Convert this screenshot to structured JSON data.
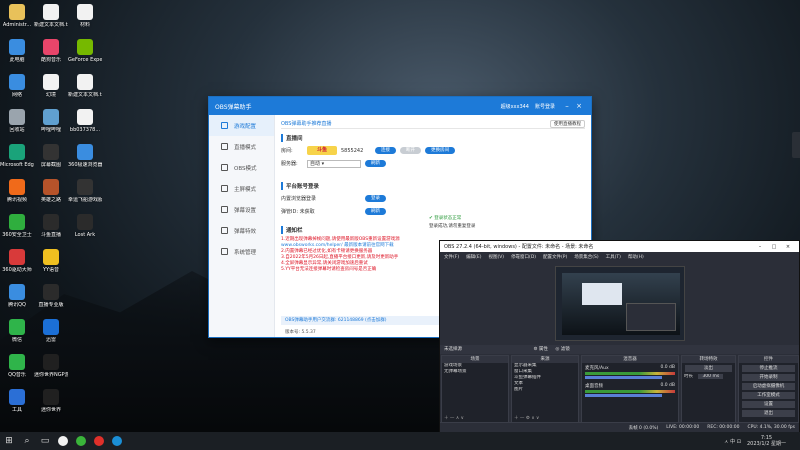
{
  "desktop": {
    "icons": [
      {
        "label": "Administr...",
        "color": "#e8c15a"
      },
      {
        "label": "此电脑",
        "color": "#3a8de0"
      },
      {
        "label": "网络",
        "color": "#3a8de0"
      },
      {
        "label": "回收站",
        "color": "#9aa4ad"
      },
      {
        "label": "Microsoft Edge",
        "color": "#1aa37a"
      },
      {
        "label": "腾讯视频",
        "color": "#f06a1a"
      },
      {
        "label": "360安全卫士",
        "color": "#2fae3e"
      },
      {
        "label": "360驱动大师",
        "color": "#d83a3a"
      },
      {
        "label": "腾讯QQ",
        "color": "#3a8de0"
      },
      {
        "label": "微信",
        "color": "#2fb44a"
      },
      {
        "label": "QQ音乐",
        "color": "#2fb44a"
      },
      {
        "label": "工具",
        "color": "#2b6fd6"
      },
      {
        "label": "新建文本文档.txt",
        "color": "#f2f2f2"
      },
      {
        "label": "酷狗音乐",
        "color": "#e8456a"
      },
      {
        "label": "幻境",
        "color": "#f2f2f2"
      },
      {
        "label": "哔哩哔哩",
        "color": "#60a0d0"
      },
      {
        "label": "屏幕截图",
        "color": "#333333"
      },
      {
        "label": "英雄之路",
        "color": "#b6532a"
      },
      {
        "label": "斗鱼直播",
        "color": "#2b2b2b"
      },
      {
        "label": "YY语音",
        "color": "#f0c020"
      },
      {
        "label": "直播专业版",
        "color": "#2b2b2b"
      },
      {
        "label": "迅雷",
        "color": "#1b6fd6"
      },
      {
        "label": "迷你世界NGP游戏",
        "color": "#202020"
      },
      {
        "label": "迷你世界",
        "color": "#202020"
      },
      {
        "label": "材料",
        "color": "#f2f2f2"
      },
      {
        "label": "GeForce Experience",
        "color": "#76b900"
      },
      {
        "label": "新建文本文档.txt",
        "color": "#f2f2f2"
      },
      {
        "label": "bb037378...",
        "color": "#f2f2f2"
      },
      {
        "label": "360极速浏览器",
        "color": "#3a8de0"
      },
      {
        "label": "幸运飞船游戏服",
        "color": "#333333"
      },
      {
        "label": "Lost Ark",
        "color": "#2b2b2b"
      }
    ]
  },
  "helper": {
    "title": "OBS弹幕助手",
    "user": "超级xxx344",
    "login": "账号登录",
    "nav": [
      "游戏配置",
      "直播模式",
      "OBS模式",
      "主屏模式",
      "弹幕设置",
      "弹幕特效",
      "系统管理"
    ],
    "breadcrumb": "OBS弹幕助手推荐直播",
    "top_button": "使用直播教程",
    "section_live": "直播间",
    "room_label": "房间:",
    "platform_logo": "斗鱼",
    "room_number": "5855242",
    "btn_connect": "连接",
    "btn_disconnect": "断开",
    "btn_change": "更换房间",
    "server_label": "服务器:",
    "server_value": "自动",
    "btn_refresh": "刷新",
    "section_account": "平台账号登录",
    "account_row1_label": "内置浏览器登录",
    "account_row1_btn": "登录",
    "account_row2_label": "弹管ID: 未获取",
    "account_row2_btn": "刷新",
    "status_ok": "登录状态正常",
    "status_detail": "登录成功,请勿重复登录",
    "section_notice": "通知栏",
    "notice_lines": [
      "1.近期出现弹幕掉帧问题,请使用最新版OBS重新设置游戏源",
      "www.obsworks.com/helper/ 最新版本请前往官网下载",
      "2.内置弹幕已经过优化,如有卡顿请更换服务器",
      "3.自2022年5月26日起,直播平台接口更新,请及时更新助手",
      "4.全屏弹幕显示异常,请关闭游戏加速后重试",
      "5.YY平台无法连接弹幕时请检查房间号是否正确"
    ],
    "notice_link": "www.obsworks.com/helper/",
    "footer": "OBS弹幕助手用户交流群: 621148869 (点击加群)",
    "version": "版本号: 5.5.37"
  },
  "obs": {
    "title": "OBS 27.2.4 (64-bit, windows) - 配置文件: 未命名 - 场景: 未命名",
    "menu": [
      "文件(F)",
      "编辑(E)",
      "视图(V)",
      "停靠窗口(D)",
      "配置文件(P)",
      "场景集合(S)",
      "工具(T)",
      "帮助(H)"
    ],
    "bar_label": "未选择源",
    "bar_props": "属性",
    "bar_filters": "滤镜",
    "docks": {
      "scenes": {
        "title": "场景",
        "items": [
          "游戏场景",
          "无弹幕场景"
        ]
      },
      "sources": {
        "title": "来源",
        "items": [
          "显示器采集",
          "窗口采集",
          "斗鱼弹幕插件",
          "文本",
          "图片"
        ]
      },
      "mixer": {
        "title": "混音器",
        "tracks": [
          {
            "name": "麦克风/Aux",
            "level": "0.0 dB"
          },
          {
            "name": "桌面音频",
            "level": "0.0 dB"
          }
        ]
      },
      "transitions": {
        "title": "转场特效",
        "type": "淡出",
        "duration_label": "时长",
        "duration": "300 ms"
      },
      "controls": {
        "title": "控件",
        "buttons": [
          "停止推流",
          "开始录制",
          "启动虚拟摄像机",
          "工作室模式",
          "设置",
          "退出"
        ]
      }
    },
    "status": {
      "fps_info": "CPU: 4.1%, 30.00 fps",
      "live_time": "LIVE: 00:00:00",
      "rec_time": "REC: 00:00:00",
      "dropped": "丢帧 0 (0.0%)"
    }
  },
  "taskbar": {
    "apps": [
      "#f2f2f2",
      "#3ab43a",
      "#e0302a",
      "#1b8fd6"
    ],
    "tray": "ㅅ  中  ⊡",
    "time": "7:15",
    "date": "2023/1/2 星期一"
  }
}
